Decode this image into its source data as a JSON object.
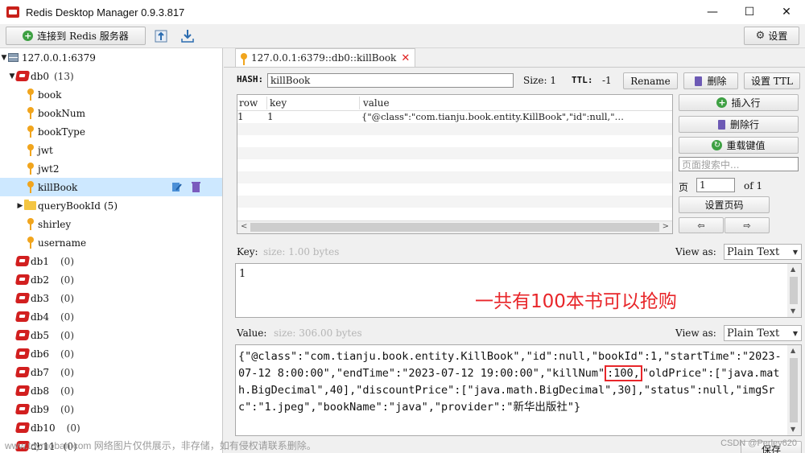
{
  "window": {
    "title": "Redis Desktop Manager 0.9.3.817",
    "controls": [
      "—",
      "☐",
      "✕"
    ]
  },
  "toolbar": {
    "connect_label": "连接到 Redis 服务器",
    "settings_label": "设置"
  },
  "tree": {
    "server": "127.0.0.1:6379",
    "db0": {
      "name": "db0",
      "count": "(13)"
    },
    "keys": [
      "book",
      "bookNum",
      "bookType",
      "jwt",
      "jwt2",
      "killBook"
    ],
    "folder": {
      "name": "queryBookId",
      "count": "(5)"
    },
    "keys_after": [
      "shirley",
      "username"
    ],
    "databases": [
      {
        "name": "db1",
        "count": "(0)"
      },
      {
        "name": "db2",
        "count": "(0)"
      },
      {
        "name": "db3",
        "count": "(0)"
      },
      {
        "name": "db4",
        "count": "(0)"
      },
      {
        "name": "db5",
        "count": "(0)"
      },
      {
        "name": "db6",
        "count": "(0)"
      },
      {
        "name": "db7",
        "count": "(0)"
      },
      {
        "name": "db8",
        "count": "(0)"
      },
      {
        "name": "db9",
        "count": "(0)"
      },
      {
        "name": "db10",
        "count": "(0)"
      },
      {
        "name": "db11",
        "count": "(0)"
      }
    ]
  },
  "tab": {
    "label": "127.0.0.1:6379::db0::killBook"
  },
  "key_header": {
    "type_label": "HASH:",
    "key_name": "killBook",
    "size_label": "Size: 1",
    "ttl_label": "TTL:",
    "ttl_value": "-1",
    "rename": "Rename",
    "delete": "删除",
    "set_ttl": "设置 TTL"
  },
  "table": {
    "columns": [
      "row",
      "key",
      "value"
    ],
    "rows": [
      {
        "row": "1",
        "key": "1",
        "value": "{\"@class\":\"com.tianju.book.entity.KillBook\",\"id\":null,\"…"
      }
    ]
  },
  "side_buttons": {
    "insert_row": "插入行",
    "delete_row": "删除行",
    "reload": "重载键值",
    "search_placeholder": "页面搜索中...",
    "page_label": "页",
    "page_value": "1",
    "page_of": "of 1",
    "set_page": "设置页码",
    "prev": "⇦",
    "next": "⇨"
  },
  "key_editor": {
    "label": "Key:",
    "size": "size: 1.00 bytes",
    "view_as_label": "View as:",
    "view_as_value": "Plain Text",
    "content": "1"
  },
  "value_editor": {
    "label": "Value:",
    "size": "size: 306.00 bytes",
    "view_as_label": "View as:",
    "view_as_value": "Plain Text",
    "content_before": "{\"@class\":\"com.tianju.book.entity.KillBook\",\"id\":null,\"bookId\":1,\"startTime\":\"2023-07-12 8:00:00\",\"endTime\":\"2023-07-12 19:00:00\",\"killNum\"",
    "content_highlight": ":100,",
    "content_after": "\"oldPrice\":[\"java.math.BigDecimal\",40],\"discountPrice\":[\"java.math.BigDecimal\",30],\"status\":null,\"imgSrc\":\"1.jpeg\",\"bookName\":\"java\",\"provider\":\"新华出版社\"}",
    "save": "保存"
  },
  "annotation": "一共有100本书可以抢购",
  "watermark": {
    "left": "www.toymoban.com 网络图片仅供展示，非存储，如有侵权请联系删除。",
    "right": "CSDN @Perley620"
  },
  "colors": {
    "selection": "#cde8ff",
    "annotation": "#e8262a",
    "db_icon": "#d21f1f",
    "key_icon": "#f1a51d"
  }
}
